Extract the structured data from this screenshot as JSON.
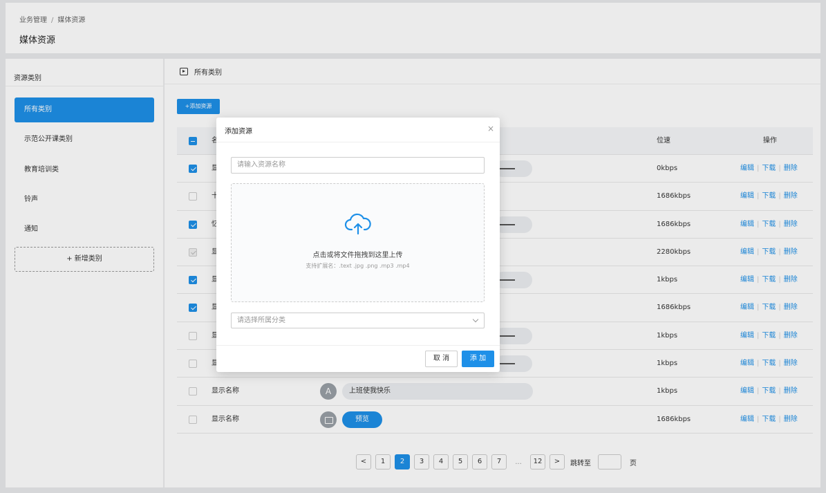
{
  "breadcrumb": {
    "parent": "业务管理",
    "separator": "/",
    "current": "媒体资源"
  },
  "page_title": "媒体资源",
  "sidebar": {
    "heading": "资源类别",
    "items": [
      {
        "label": "所有类别",
        "active": true
      },
      {
        "label": "示范公开课类别",
        "active": false
      },
      {
        "label": "教育培训类",
        "active": false
      },
      {
        "label": "铃声",
        "active": false
      },
      {
        "label": "通知",
        "active": false
      }
    ],
    "add_label": "+ 新增类别"
  },
  "main": {
    "heading": "所有类别",
    "add_button": "+添加资源"
  },
  "table": {
    "columns": {
      "name": "名",
      "bitrate": "位速",
      "ops": "操作"
    },
    "ops": {
      "edit": "编辑",
      "download": "下载",
      "delete": "删除"
    },
    "rows": [
      {
        "checkbox": "checked",
        "name": "显",
        "bitrate": "0kbps"
      },
      {
        "checkbox": "none",
        "name": "十",
        "bitrate": "1686kbps"
      },
      {
        "checkbox": "checked",
        "name": "忆",
        "bitrate": "1686kbps"
      },
      {
        "checkbox": "disabled",
        "name": "显",
        "bitrate": "2280kbps"
      },
      {
        "checkbox": "checked",
        "name": "显",
        "bitrate": "1kbps"
      },
      {
        "checkbox": "checked",
        "name": "显",
        "bitrate": "1686kbps"
      },
      {
        "checkbox": "none",
        "name": "显",
        "bitrate": "1kbps"
      },
      {
        "checkbox": "none",
        "name": "显",
        "bitrate": "1kbps"
      },
      {
        "checkbox": "none",
        "name": "显示名称",
        "bitrate": "1kbps",
        "avatar": "A",
        "media_text": "上班使我快乐"
      },
      {
        "checkbox": "none",
        "name": "显示名称",
        "bitrate": "1686kbps",
        "preview": "预览"
      }
    ]
  },
  "pagination": {
    "prev": "<",
    "next": ">",
    "pages": [
      "1",
      "2",
      "3",
      "4",
      "5",
      "6",
      "7"
    ],
    "active": "2",
    "ellipsis": "...",
    "last": "12",
    "jump_label": "跳转至",
    "page_suffix": "页"
  },
  "modal": {
    "title": "添加资源",
    "close": "×",
    "name_placeholder": "请输入资源名称",
    "upload_text": "点击或将文件拖拽到这里上传",
    "upload_hint": "支持扩展名：.text .jpg .png .mp3 .mp4",
    "category_placeholder": "请选择所属分类",
    "cancel_label": "取 消",
    "add_label": "添 加"
  },
  "colors": {
    "accent": "#1e90e8"
  }
}
